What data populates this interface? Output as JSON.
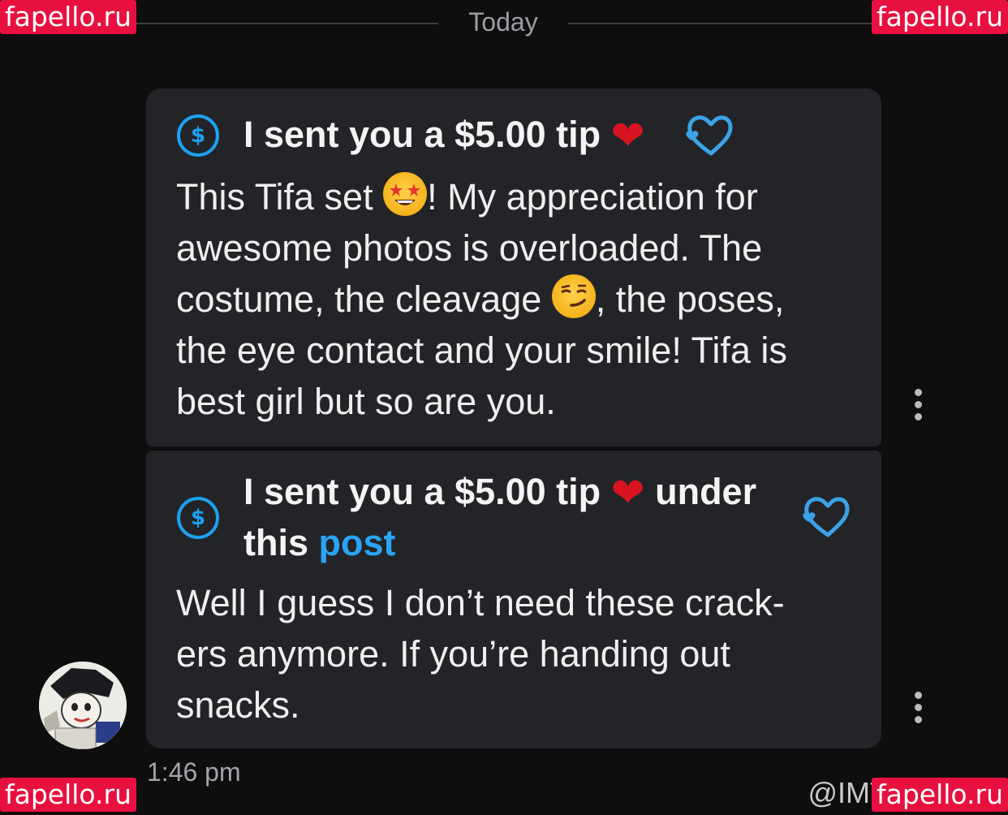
{
  "divider": {
    "label": "Today"
  },
  "watermarks": {
    "top_left": "fapello.ru",
    "top_right": "fapello.ru",
    "bottom_left": "fapello.ru",
    "bottom_right": "fapello.ru"
  },
  "messages": [
    {
      "tip_text": "I sent you a $5.00 tip",
      "heart": "❤",
      "body": {
        "part1": "This Tifa set ",
        "part2": "! My appreciation for",
        "line2": "awesome photos is overloaded. The",
        "line3a": "costume, the cleavage ",
        "line3b": ", the poses,",
        "line4": "the eye contact and your smile! Tifa is",
        "line5": "best girl but so are you."
      }
    },
    {
      "tip_text": "I sent you a $5.00 tip",
      "heart": "❤",
      "tip_suffix": "under",
      "tip_line2_prefix": "this ",
      "tip_link": "post",
      "body": {
        "line1": "Well I guess I don’t need these crack-",
        "line2": "ers anymore. If you’re handing out",
        "line3": "snacks."
      }
    }
  ],
  "icons": {
    "dollar": "$",
    "like": "heart-outline-icon",
    "options": "kebab-menu-icon"
  },
  "timestamp": "1:46 pm",
  "handle": "@IMT",
  "colors": {
    "background": "#0e0e0f",
    "bubble": "#222427",
    "accent_blue": "#1da1f2",
    "heart_red": "#d91422",
    "watermark": "#e8103f"
  }
}
